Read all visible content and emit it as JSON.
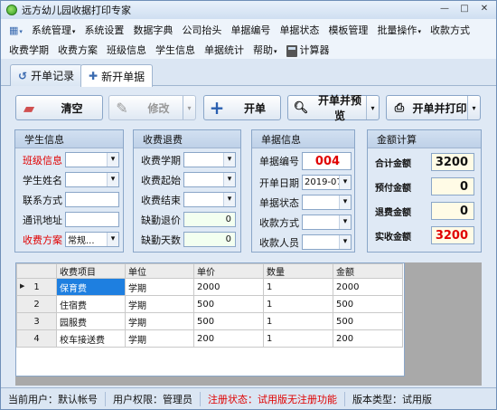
{
  "window": {
    "title": "远方幼儿园收据打印专家",
    "minimize": "—",
    "maximize": "□",
    "close": "✕"
  },
  "menu": {
    "row1": [
      {
        "label": "系统管理",
        "has_arrow": true
      },
      {
        "label": "系统设置",
        "has_arrow": false
      },
      {
        "label": "数据字典",
        "has_arrow": false
      },
      {
        "label": "公司抬头",
        "has_arrow": false
      },
      {
        "label": "单据编号",
        "has_arrow": false
      },
      {
        "label": "单据状态",
        "has_arrow": false
      },
      {
        "label": "模板管理",
        "has_arrow": false
      },
      {
        "label": "批量操作",
        "has_arrow": true
      },
      {
        "label": "收款方式",
        "has_arrow": false
      }
    ],
    "row2": [
      {
        "label": "收费学期",
        "has_arrow": false
      },
      {
        "label": "收费方案",
        "has_arrow": false
      },
      {
        "label": "班级信息",
        "has_arrow": false
      },
      {
        "label": "学生信息",
        "has_arrow": false
      },
      {
        "label": "单据统计",
        "has_arrow": false
      },
      {
        "label": "帮助",
        "has_arrow": true
      }
    ],
    "calculator": "计算器"
  },
  "tabs": [
    {
      "label": "开单记录",
      "icon": "history-icon"
    },
    {
      "label": "新开单据",
      "icon": "plus-icon"
    }
  ],
  "toolbar": {
    "clear": "清空",
    "modify": "修改",
    "new_bill": "开单",
    "bill_preview": "开单并预览",
    "bill_print": "开单并打印"
  },
  "student_panel": {
    "title": "学生信息",
    "class_label": "班级信息",
    "name_label": "学生姓名",
    "contact_label": "联系方式",
    "address_label": "通讯地址",
    "plan_label": "收费方案",
    "plan_value": "常规..."
  },
  "fee_panel": {
    "title": "收费退费",
    "term_label": "收费学期",
    "start_label": "收费起始",
    "end_label": "收费结束",
    "absent_price_label": "缺勤退价",
    "absent_price_value": "0",
    "absent_days_label": "缺勤天数",
    "absent_days_value": "0"
  },
  "bill_panel": {
    "title": "单据信息",
    "no_label": "单据编号",
    "no_value": "004",
    "date_label": "开单日期",
    "date_value": "2019-07-",
    "status_label": "单据状态",
    "pay_label": "收款方式",
    "payee_label": "收款人员"
  },
  "amount_panel": {
    "title": "金额计算",
    "total_label": "合计金额",
    "total_value": "3200",
    "prepaid_label": "预付金额",
    "prepaid_value": "0",
    "refund_label": "退费金额",
    "refund_value": "0",
    "actual_label": "实收金额",
    "actual_value": "3200"
  },
  "grid": {
    "columns": [
      "收费项目",
      "单位",
      "单价",
      "数量",
      "金额"
    ],
    "rows": [
      {
        "no": "1",
        "item": "保育费",
        "unit": "学期",
        "price": "2000",
        "qty": "1",
        "amount": "2000"
      },
      {
        "no": "2",
        "item": "住宿费",
        "unit": "学期",
        "price": "500",
        "qty": "1",
        "amount": "500"
      },
      {
        "no": "3",
        "item": "园服费",
        "unit": "学期",
        "price": "500",
        "qty": "1",
        "amount": "500"
      },
      {
        "no": "4",
        "item": "校车接送费",
        "unit": "学期",
        "price": "200",
        "qty": "1",
        "amount": "200"
      }
    ]
  },
  "status": {
    "user": "当前用户：默认帐号",
    "perm": "用户权限：管理员",
    "reg": "注册状态：试用版无注册功能",
    "version": "版本类型：试用版"
  },
  "colors": {
    "accent_red": "#e00000",
    "selection": "#1e7fe0"
  }
}
